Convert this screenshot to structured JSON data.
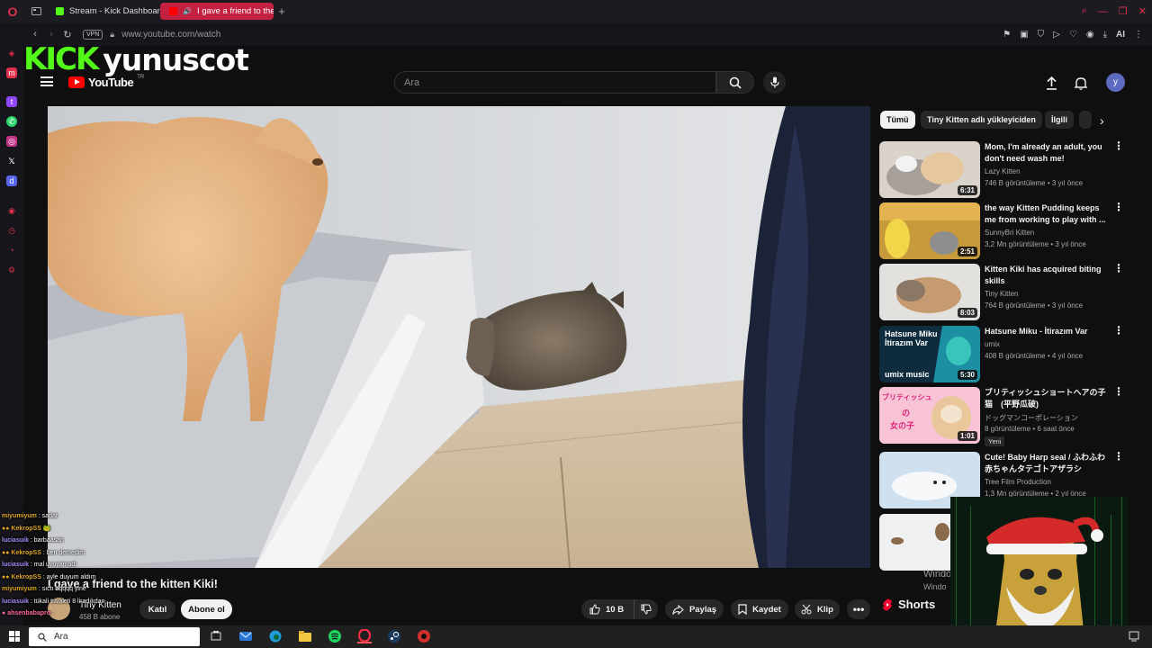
{
  "browser": {
    "tabs": [
      {
        "label": "Stream - Kick Dashboard",
        "active": false
      },
      {
        "label": "I gave a friend to the k",
        "active": true
      }
    ],
    "vpn_label": "VPN",
    "url": "www.youtube.com/watch",
    "ai_label": "AI"
  },
  "overlay": {
    "kick_logo": "KICK",
    "streamer_name": "yunuscot"
  },
  "youtube": {
    "logo_text": "YouTube",
    "country_code": "TR",
    "search_placeholder": "Ara",
    "avatar_letter": "y"
  },
  "video": {
    "title": "I gave a friend to the kitten Kiki!",
    "channel": "Tiny Kitten",
    "subscribers": "458 B abone",
    "join_label": "Katıl",
    "subscribe_label": "Abone ol",
    "likes": "10 B",
    "share_label": "Paylaş",
    "save_label": "Kaydet",
    "clip_label": "Klip"
  },
  "chips": [
    "Tümü",
    "Tiny Kitten adlı yükleyiciden",
    "İlgili"
  ],
  "recommendations": [
    {
      "title": "Mom, I'm already an adult, you don't need wash me!",
      "channel": "Lazy Kitten",
      "meta": "746 B görüntüleme • 3 yıl önce",
      "duration": "6:31",
      "badge": ""
    },
    {
      "title": "the way Kitten Pudding keeps me from working to play with ...",
      "channel": "SunnyBri Kitten",
      "meta": "3,2 Mn görüntüleme • 3 yıl önce",
      "duration": "2:51",
      "badge": ""
    },
    {
      "title": "Kitten Kiki has acquired biting skills",
      "channel": "Tiny Kitten",
      "meta": "764 B görüntüleme • 3 yıl önce",
      "duration": "8:03",
      "badge": ""
    },
    {
      "title": "Hatsune Miku - İtirazım Var",
      "channel": "umix",
      "meta": "408 B görüntüleme • 4 yıl önce",
      "duration": "5:30",
      "badge": ""
    },
    {
      "title": "ブリティッシュショートヘアの子猫　(平野瓜破)",
      "channel": "ドッグマンコーポレーション",
      "meta": "8 görüntüleme • 6 saat önce",
      "duration": "1:01",
      "badge": "Yeni"
    },
    {
      "title": "Cute! Baby Harp seal / ふわふわ赤ちゃんタテゴトアザラシ",
      "channel": "Tree Film Production",
      "meta": "1,3 Mn görüntüleme • 2 yıl önce",
      "duration": "",
      "badge": ""
    }
  ],
  "thumb_texts": {
    "miku_line1": "Hatsune Miku",
    "miku_line2": "İtirazım Var",
    "miku_brand": "umix music",
    "jp_line1": "ブリティッシュ",
    "jp_line2": "の",
    "jp_line3": "女の子"
  },
  "shorts_label": "Shorts",
  "windows_watermark": [
    "Windo",
    "Windo"
  ],
  "chat": [
    {
      "user": "miyumiyum",
      "text": " : sadat",
      "color": "#e0a526"
    },
    {
      "user": "KekropSS",
      "text": "",
      "color": "#e0a526",
      "badge": true
    },
    {
      "user": "luciasuik",
      "text": " : barbaasan",
      "color": "#a78bfa"
    },
    {
      "user": "KekropSS",
      "text": " : ben demedim",
      "color": "#e0a526",
      "badge": true
    },
    {
      "user": "luciasuik",
      "text": " : mal uyuyamadı",
      "color": "#a78bfa"
    },
    {
      "user": "KekropSS",
      "text": " : ayle duyum aldım",
      "color": "#e0a526",
      "badge": true
    },
    {
      "user": "miyumiyum",
      "text": " : sıctı aqqqq yine",
      "color": "#e0a526"
    },
    {
      "user": "luciasuik",
      "text": " : tükali tuvaleti 8 liradıkdan",
      "color": "#a78bfa"
    },
    {
      "user": "ahsenbabapro",
      "text": " : ",
      "color": "#ff6b9a",
      "badge": true
    }
  ],
  "taskbar": {
    "search_text": "Ara"
  },
  "colors": {
    "kick_green": "#53fc18",
    "opera_red": "#e0314b",
    "youtube_red": "#ff0000"
  }
}
